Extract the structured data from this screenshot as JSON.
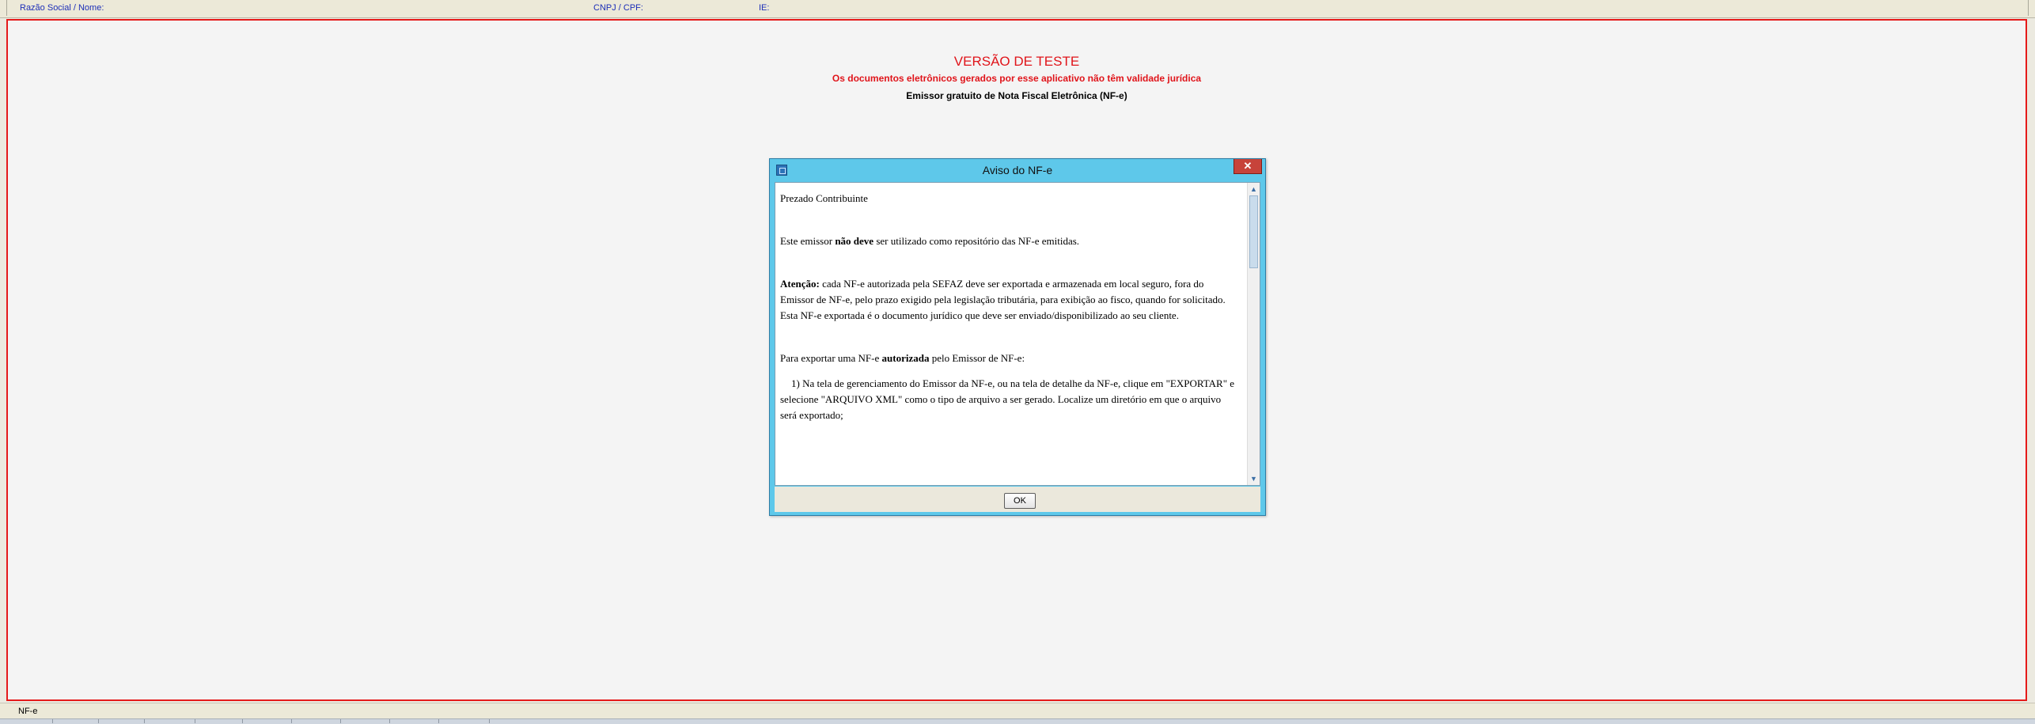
{
  "topbar": {
    "razao_label": "Razão Social / Nome:",
    "cnpj_label": "CNPJ / CPF:",
    "ie_label": "IE:"
  },
  "banner": {
    "title": "VERSÃO DE TESTE",
    "subtitle": "Os documentos eletrônicos gerados por esse aplicativo não têm validade jurídica",
    "description": "Emissor gratuito de Nota Fiscal Eletrônica (NF-e)"
  },
  "dialog": {
    "title": "Aviso do NF-e",
    "close_label": "✕",
    "greeting": "Prezado Contribuinte",
    "p1_pre": "Este emissor ",
    "p1_bold": "não deve",
    "p1_post": " ser utilizado como repositório das NF-e emitidas.",
    "p2_bold": "Atenção:",
    "p2_text": " cada NF-e autorizada pela SEFAZ deve ser exportada e armazenada em local seguro, fora do Emissor de NF-e, pelo prazo exigido pela legislação tributária, para exibição ao fisco, quando for solicitado. Esta NF-e exportada é o documento jurídico que deve ser enviado/disponibilizado ao seu cliente.",
    "p3_pre": "Para exportar uma NF-e ",
    "p3_bold": "autorizada",
    "p3_post": " pelo Emissor de NF-e:",
    "p4": "1) Na tela de gerenciamento do Emissor da NF-e, ou na tela de detalhe da NF-e, clique em \"EXPORTAR\" e selecione \"ARQUIVO XML\" como o tipo de arquivo a ser gerado. Localize um diretório em que o arquivo será exportado;",
    "ok_label": "OK"
  },
  "status": {
    "label": "NF-e"
  },
  "colors": {
    "warning_red": "#e0141a",
    "dialog_frame": "#5ec8ea",
    "label_blue": "#1d2fb8"
  }
}
